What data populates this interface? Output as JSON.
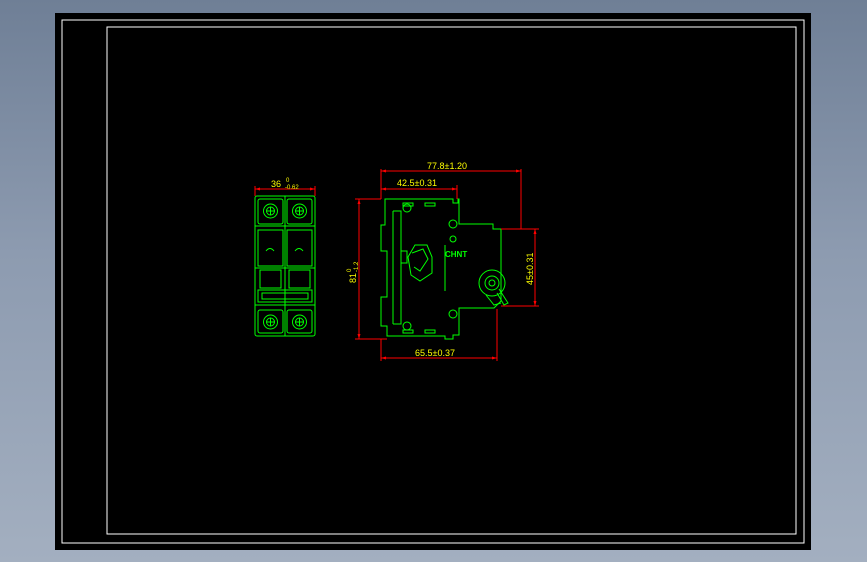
{
  "drawing": {
    "colors": {
      "background": "#000000",
      "frame": "#ffffff",
      "outline": "#00ff00",
      "dimension_line": "#ff0000",
      "dimension_text": "#ffff00"
    },
    "front_view": {
      "width_dim": {
        "value": "36",
        "tol_upper": "0",
        "tol_lower": "-0.62"
      }
    },
    "side_view": {
      "overall_width": "77.8±1.20",
      "rail_to_front": "42.5±0.31",
      "height_dim": {
        "value": "81",
        "tol_upper": "0",
        "tol_lower": "-1.2"
      },
      "front_height": "45±0.31",
      "base_depth": "65.5±0.37",
      "brand_logo": "CHNT"
    }
  }
}
